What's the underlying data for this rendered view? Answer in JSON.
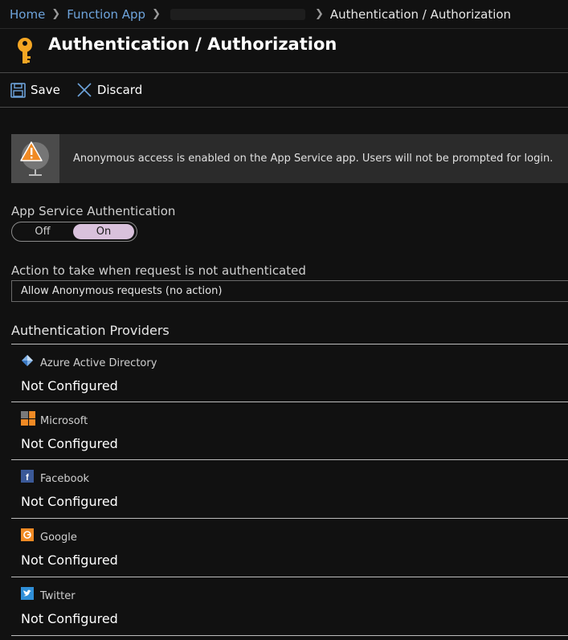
{
  "breadcrumb": {
    "home": "Home",
    "function_app": "Function App",
    "current": "Authentication / Authorization"
  },
  "header": {
    "title": "Authentication / Authorization",
    "icon": "key-icon"
  },
  "toolbar": {
    "save_label": "Save",
    "discard_label": "Discard"
  },
  "banner": {
    "text": "Anonymous access is enabled on the App Service app. Users will not be prompted for login.",
    "icon": "warning-icon"
  },
  "app_service_auth": {
    "label": "App Service Authentication",
    "off_label": "Off",
    "on_label": "On",
    "selected": "On"
  },
  "action": {
    "label": "Action to take when request is not authenticated",
    "value": "Allow Anonymous requests (no action)"
  },
  "providers": {
    "title": "Authentication Providers",
    "items": [
      {
        "name": "Azure Active Directory",
        "status": "Not Configured",
        "icon": "azure-ad-icon"
      },
      {
        "name": "Microsoft",
        "status": "Not Configured",
        "icon": "microsoft-icon"
      },
      {
        "name": "Facebook",
        "status": "Not Configured",
        "icon": "facebook-icon"
      },
      {
        "name": "Google",
        "status": "Not Configured",
        "icon": "google-icon"
      },
      {
        "name": "Twitter",
        "status": "Not Configured",
        "icon": "twitter-icon"
      }
    ]
  },
  "colors": {
    "accent_link": "#6ea4dc",
    "toggle_on": "#d9c1dc",
    "key": "#f5a623",
    "warning": "#f08a24"
  }
}
